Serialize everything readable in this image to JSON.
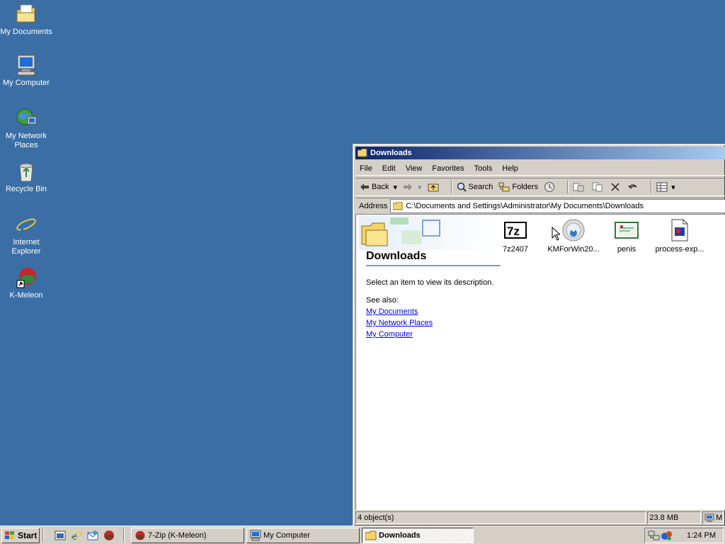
{
  "desktop": {
    "icons": [
      {
        "label": "My Documents"
      },
      {
        "label": "My Computer"
      },
      {
        "label": "My Network Places"
      },
      {
        "label": "Recycle Bin"
      },
      {
        "label": "Internet Explorer"
      },
      {
        "label": "K-Meleon"
      }
    ]
  },
  "window": {
    "title": "Downloads",
    "menu": [
      "File",
      "Edit",
      "View",
      "Favorites",
      "Tools",
      "Help"
    ],
    "toolbar": {
      "back": "Back",
      "search": "Search",
      "folders": "Folders"
    },
    "address": {
      "label": "Address",
      "value": "C:\\Documents and Settings\\Administrator\\My Documents\\Downloads"
    },
    "webview": {
      "title": "Downloads",
      "description": "Select an item to view its description.",
      "see_also_label": "See also:",
      "links": [
        "My Documents",
        "My Network Places",
        "My Computer"
      ]
    },
    "files": [
      {
        "name": "7z2407",
        "icon": "7zip-icon"
      },
      {
        "name": "KMForWin20...",
        "icon": "installer-cd-icon"
      },
      {
        "name": "penis",
        "icon": "certificate-icon"
      },
      {
        "name": "process-exp...",
        "icon": "executable-icon"
      }
    ],
    "status": {
      "objects": "4 object(s)",
      "size": "23.8 MB",
      "zone": "M"
    }
  },
  "taskbar": {
    "start": "Start",
    "tasks": [
      {
        "label": "7-Zip (K-Meleon)",
        "active": false
      },
      {
        "label": "My Computer",
        "active": false
      },
      {
        "label": "Downloads",
        "active": true
      }
    ],
    "clock": "1:24 PM"
  },
  "colors": {
    "desktop": "#3a6ea5",
    "titlebar_start": "#0a246a",
    "titlebar_end": "#a6caf0",
    "chrome": "#d4d0c8"
  }
}
